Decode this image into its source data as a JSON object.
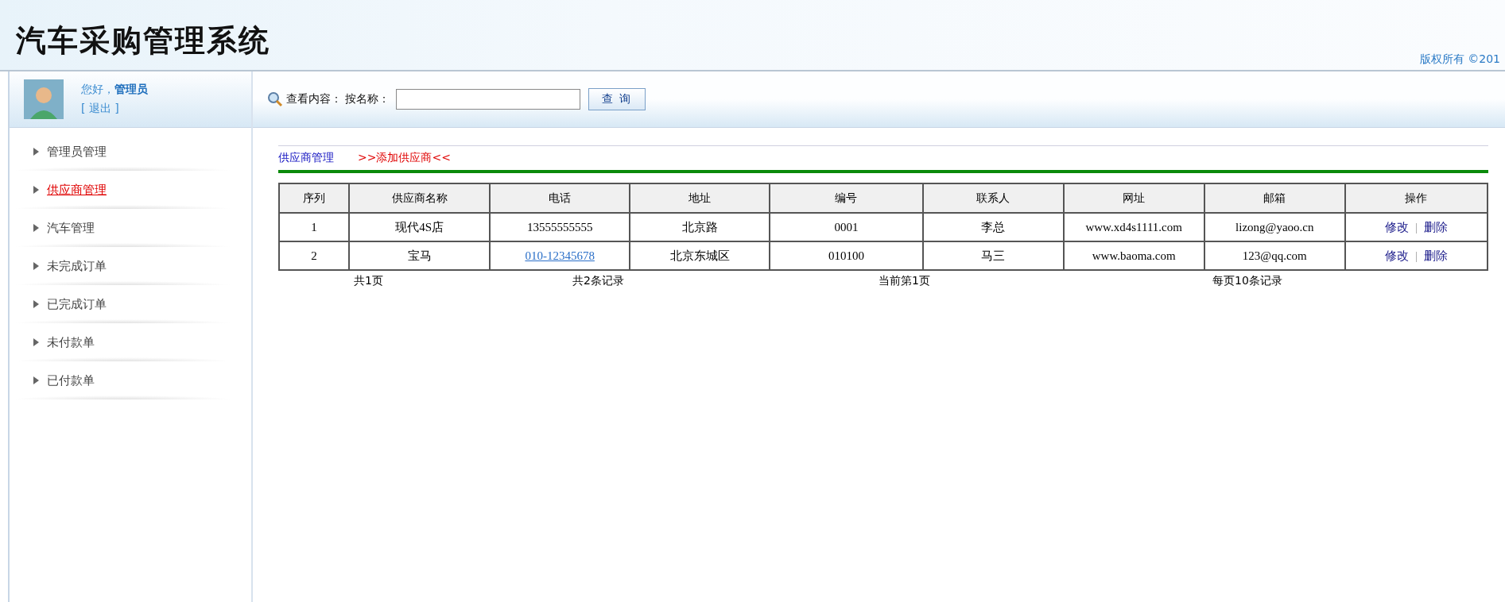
{
  "header": {
    "title": "汽车采购管理系统",
    "copyright": "版权所有 ©201"
  },
  "user": {
    "greeting": "您好，",
    "name": "管理员",
    "logout": "[ 退出 ]"
  },
  "search": {
    "label": "查看内容：",
    "field_label": "按名称：",
    "button": "查 询"
  },
  "sidebar": {
    "items": [
      {
        "label": "管理员管理",
        "selected": false
      },
      {
        "label": "供应商管理",
        "selected": true
      },
      {
        "label": "汽车管理",
        "selected": false
      },
      {
        "label": "未完成订单",
        "selected": false
      },
      {
        "label": "已完成订单",
        "selected": false
      },
      {
        "label": "未付款单",
        "selected": false
      },
      {
        "label": "已付款单",
        "selected": false
      }
    ]
  },
  "content": {
    "breadcrumb": "供应商管理",
    "add_link": ">>添加供应商<<"
  },
  "table": {
    "columns": [
      "序列",
      "供应商名称",
      "电话",
      "地址",
      "编号",
      "联系人",
      "网址",
      "邮箱",
      "操作"
    ],
    "rows": [
      {
        "index": "1",
        "name": "现代4S店",
        "phone": "13555555555",
        "phone_link": false,
        "address": "北京路",
        "code": "0001",
        "contact": "李总",
        "website": "www.xd4s1111.com",
        "email": "lizong@yaoo.cn",
        "edit": "修改",
        "separator": "|",
        "delete": "删除"
      },
      {
        "index": "2",
        "name": "宝马",
        "phone": "010-12345678",
        "phone_link": true,
        "address": "北京东城区",
        "code": "010100",
        "contact": "马三",
        "website": "www.baoma.com",
        "email": "123@qq.com",
        "edit": "修改",
        "separator": "|",
        "delete": "删除"
      }
    ]
  },
  "pagination": {
    "pages": "共1页",
    "records": "共2条记录",
    "current": "当前第1页",
    "per_page": "每页10条记录"
  }
}
